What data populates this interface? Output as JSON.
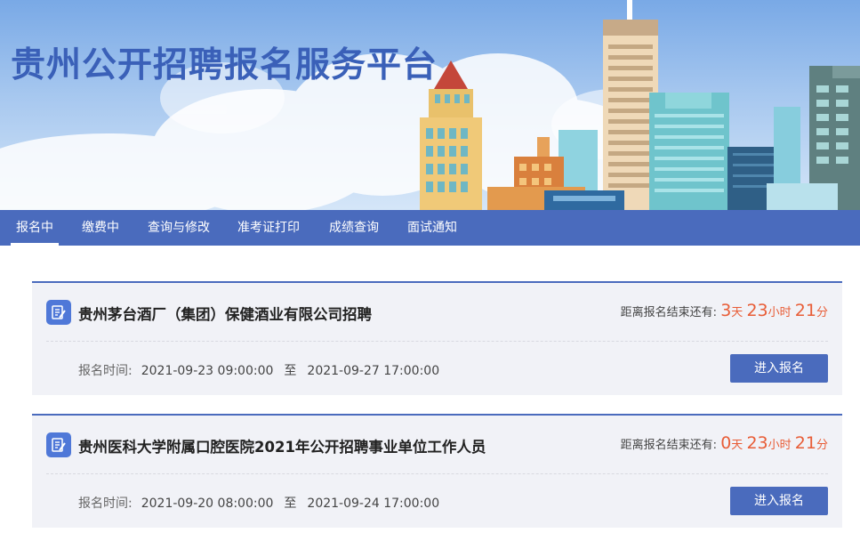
{
  "banner": {
    "title": "贵州公开招聘报名服务平台"
  },
  "nav": {
    "items": [
      {
        "label": "报名中",
        "active": true
      },
      {
        "label": "缴费中",
        "active": false
      },
      {
        "label": "查询与修改",
        "active": false
      },
      {
        "label": "准考证打印",
        "active": false
      },
      {
        "label": "成绩查询",
        "active": false
      },
      {
        "label": "面试通知",
        "active": false
      }
    ]
  },
  "recruitments": [
    {
      "title": "贵州茅台酒厂（集团）保健酒业有限公司招聘",
      "countdown_label": "距离报名结束还有:",
      "days": "3",
      "day_unit": "天",
      "hours": "23",
      "hour_unit": "小时",
      "minutes": "21",
      "minute_unit": "分",
      "time_label": "报名时间:",
      "start": "2021-09-23 09:00:00",
      "to": "至",
      "end": "2021-09-27 17:00:00",
      "button": "进入报名"
    },
    {
      "title": "贵州医科大学附属口腔医院2021年公开招聘事业单位工作人员",
      "countdown_label": "距离报名结束还有:",
      "days": "0",
      "day_unit": "天",
      "hours": "23",
      "hour_unit": "小时",
      "minutes": "21",
      "minute_unit": "分",
      "time_label": "报名时间:",
      "start": "2021-09-20 08:00:00",
      "to": "至",
      "end": "2021-09-24 17:00:00",
      "button": "进入报名"
    }
  ],
  "colors": {
    "primary": "#4a6bbd",
    "accent": "#e85d37",
    "title": "#3a60b8",
    "card_bg": "#f1f2f7"
  }
}
